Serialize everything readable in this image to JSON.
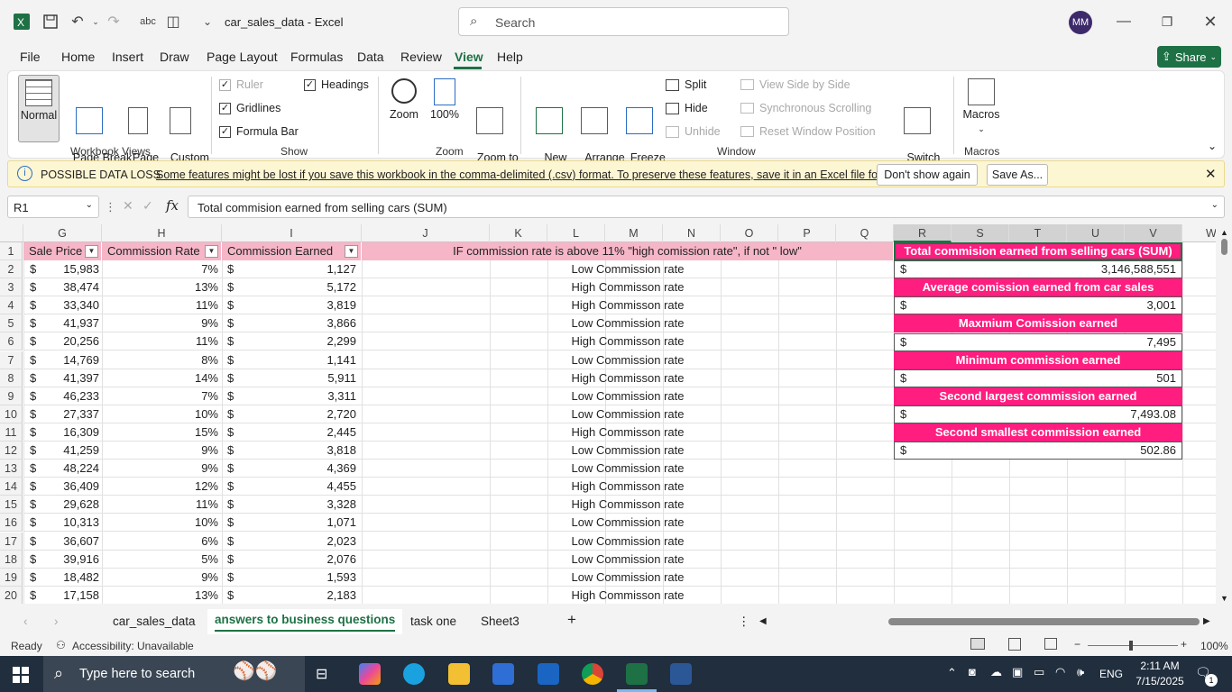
{
  "window": {
    "title": "car_sales_data  -  Excel",
    "search_placeholder": "Search",
    "user_initials": "MM"
  },
  "menu": [
    "File",
    "Home",
    "Insert",
    "Draw",
    "Page Layout",
    "Formulas",
    "Data",
    "Review",
    "View",
    "Help"
  ],
  "active_menu": "View",
  "share_label": "Share",
  "ribbon": {
    "workbook_views": {
      "label": "Workbook Views",
      "normal": "Normal",
      "page_break": "Page Break\nPreview",
      "page_layout": "Page\nLayout",
      "custom_views": "Custom\nViews"
    },
    "show": {
      "label": "Show",
      "ruler": "Ruler",
      "gridlines": "Gridlines",
      "formula_bar": "Formula Bar",
      "headings": "Headings"
    },
    "zoom": {
      "label": "Zoom",
      "zoom": "Zoom",
      "hundred": "100%",
      "zoom_sel": "Zoom to\nSelection"
    },
    "window": {
      "label": "Window",
      "new_window": "New\nWindow",
      "arrange_all": "Arrange\nAll",
      "freeze": "Freeze\nPanes",
      "split": "Split",
      "hide": "Hide",
      "unhide": "Unhide",
      "side_by_side": "View Side by Side",
      "sync_scroll": "Synchronous Scrolling",
      "reset_pos": "Reset Window Position",
      "switch": "Switch\nWindows"
    },
    "macros": {
      "label": "Macros",
      "macros": "Macros"
    }
  },
  "banner": {
    "title": "POSSIBLE DATA LOSS",
    "message": "Some features might be lost if you save this workbook in the comma-delimited (.csv) format. To preserve these features, save it in an Excel file format.",
    "dont_show": "Don't show again",
    "save_as": "Save As..."
  },
  "formula": {
    "cell_ref": "R1",
    "content": "Total commision earned from selling cars (SUM)"
  },
  "columns": [
    "G",
    "H",
    "I",
    "J",
    "K",
    "L",
    "M",
    "N",
    "O",
    "P",
    "Q",
    "R",
    "S",
    "T",
    "U",
    "V"
  ],
  "headers": {
    "g": "Sale Price",
    "h": "Commission Rate",
    "i": "Commission Earned",
    "j": "IF commission rate is above 11% \"high  comission rate\", if not \" low\""
  },
  "rows": [
    {
      "n": "2",
      "price": "15,983",
      "rate": "7%",
      "earned": "1,127",
      "label": "Low Commission rate"
    },
    {
      "n": "3",
      "price": "38,474",
      "rate": "13%",
      "earned": "5,172",
      "label": "High Commisson rate"
    },
    {
      "n": "4",
      "price": "33,340",
      "rate": "11%",
      "earned": "3,819",
      "label": "High Commisson rate"
    },
    {
      "n": "5",
      "price": "41,937",
      "rate": "9%",
      "earned": "3,866",
      "label": "Low Commission rate"
    },
    {
      "n": "6",
      "price": "20,256",
      "rate": "11%",
      "earned": "2,299",
      "label": "High Commisson rate"
    },
    {
      "n": "7",
      "price": "14,769",
      "rate": "8%",
      "earned": "1,141",
      "label": "Low Commission rate"
    },
    {
      "n": "8",
      "price": "41,397",
      "rate": "14%",
      "earned": "5,911",
      "label": "High Commisson rate"
    },
    {
      "n": "9",
      "price": "46,233",
      "rate": "7%",
      "earned": "3,311",
      "label": "Low Commission rate"
    },
    {
      "n": "10",
      "price": "27,337",
      "rate": "10%",
      "earned": "2,720",
      "label": "Low Commission rate"
    },
    {
      "n": "11",
      "price": "16,309",
      "rate": "15%",
      "earned": "2,445",
      "label": "High Commisson rate"
    },
    {
      "n": "12",
      "price": "41,259",
      "rate": "9%",
      "earned": "3,818",
      "label": "Low Commission rate"
    },
    {
      "n": "13",
      "price": "48,224",
      "rate": "9%",
      "earned": "4,369",
      "label": "Low Commission rate"
    },
    {
      "n": "14",
      "price": "36,409",
      "rate": "12%",
      "earned": "4,455",
      "label": "High Commisson rate"
    },
    {
      "n": "15",
      "price": "29,628",
      "rate": "11%",
      "earned": "3,328",
      "label": "High Commisson rate"
    },
    {
      "n": "16",
      "price": "10,313",
      "rate": "10%",
      "earned": "1,071",
      "label": "Low Commission rate"
    },
    {
      "n": "17",
      "price": "36,607",
      "rate": "6%",
      "earned": "2,023",
      "label": "Low Commission rate"
    },
    {
      "n": "18",
      "price": "39,916",
      "rate": "5%",
      "earned": "2,076",
      "label": "Low Commission rate"
    },
    {
      "n": "19",
      "price": "18,482",
      "rate": "9%",
      "earned": "1,593",
      "label": "Low Commission rate"
    },
    {
      "n": "20",
      "price": "17,158",
      "rate": "13%",
      "earned": "2,183",
      "label": "High Commisson rate"
    }
  ],
  "summary": [
    {
      "title": "Total commision earned from selling cars (SUM)",
      "value": "3,146,588,551"
    },
    {
      "title": "Average comission earned from car sales",
      "value": "3,001"
    },
    {
      "title": "Maxmium Comission earned",
      "value": "7,495"
    },
    {
      "title": "Minimum commission earned",
      "value": "501"
    },
    {
      "title": "Second largest commission earned",
      "value": "7,493.08"
    },
    {
      "title": "Second smallest commission earned",
      "value": "502.86"
    }
  ],
  "currency": "$",
  "sheets": [
    "car_sales_data",
    "answers to business questions",
    "task one",
    "Sheet3"
  ],
  "active_sheet": "answers to business questions",
  "status": {
    "ready": "Ready",
    "accessibility": "Accessibility: Unavailable",
    "zoom": "100%"
  },
  "taskbar": {
    "search": "Type here to search",
    "time": "2:11 AM",
    "date": "7/15/2025",
    "lang": "ENG",
    "notif": "1"
  },
  "colors": {
    "accent_pink": "#ff1d7f",
    "header_pink": "#f6b6c8",
    "excel_green": "#1e7145"
  }
}
